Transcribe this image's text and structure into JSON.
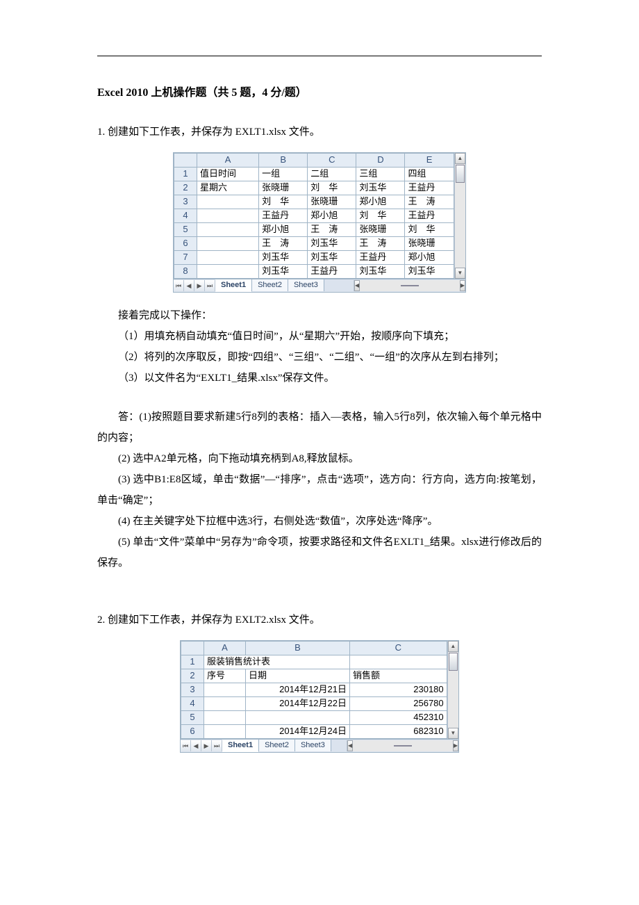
{
  "title": "Excel 2010 上机操作题（共 5 题，4 分/题）",
  "q1_line": "1. 创建如下工作表，并保存为 EXLT1.xlsx 文件。",
  "table1": {
    "cols": [
      "A",
      "B",
      "C",
      "D",
      "E"
    ],
    "rows": [
      {
        "n": "1",
        "cells": [
          "值日时间",
          "一组",
          "二组",
          "三组",
          "四组"
        ]
      },
      {
        "n": "2",
        "cells": [
          "星期六",
          "张晓珊",
          "刘　华",
          "刘玉华",
          "王益丹"
        ]
      },
      {
        "n": "3",
        "cells": [
          "",
          "刘　华",
          "张晓珊",
          "郑小旭",
          "王　涛"
        ]
      },
      {
        "n": "4",
        "cells": [
          "",
          "王益丹",
          "郑小旭",
          "刘　华",
          "王益丹"
        ]
      },
      {
        "n": "5",
        "cells": [
          "",
          "郑小旭",
          "王　涛",
          "张晓珊",
          "刘　华"
        ]
      },
      {
        "n": "6",
        "cells": [
          "",
          "王　涛",
          "刘玉华",
          "王　涛",
          "张晓珊"
        ]
      },
      {
        "n": "7",
        "cells": [
          "",
          "刘玉华",
          "刘玉华",
          "王益丹",
          "郑小旭"
        ]
      },
      {
        "n": "8",
        "cells": [
          "",
          "刘玉华",
          "王益丹",
          "刘玉华",
          "刘玉华"
        ]
      }
    ],
    "tabs": [
      "Sheet1",
      "Sheet2",
      "Sheet3"
    ]
  },
  "p_intro": "接着完成以下操作：",
  "p1": "（1）用填充柄自动填充“值日时间”，从“星期六”开始，按顺序向下填充；",
  "p2": "（2）将列的次序取反，即按“四组”、“三组”、“二组”、“一组”的次序从左到右排列；",
  "p3": "（3）以文件名为“EXLT1_结果.xlsx”保存文件。",
  "a_label": "答：",
  "a1": "(1)按照题目要求新建5行8列的表格：插入—表格，输入5行8列，依次输入每个单元格中的内容；",
  "a2": "(2) 选中A2单元格，向下拖动填充柄到A8,释放鼠标。",
  "a3": "(3) 选中B1:E8区域，单击“数据”—“排序”，点击“选项”，选方向：行方向，选方向:按笔划，单击“确定”；",
  "a4": "(4) 在主关键字处下拉框中选3行，右侧处选“数值”，次序处选“降序”。",
  "a5": "(5) 单击“文件”菜单中“另存为”命令项，按要求路径和文件名EXLT1_结果。xlsx进行修改后的保存。",
  "q2_line": "2. 创建如下工作表，并保存为 EXLT2.xlsx 文件。",
  "table2": {
    "cols": [
      "A",
      "B",
      "C"
    ],
    "rows": [
      {
        "n": "1",
        "cells": [
          "服装销售统计表",
          "",
          ""
        ]
      },
      {
        "n": "2",
        "cells": [
          "序号",
          "日期",
          "销售额"
        ]
      },
      {
        "n": "3",
        "cells": [
          "",
          "2014年12月21日",
          "230180"
        ]
      },
      {
        "n": "4",
        "cells": [
          "",
          "2014年12月22日",
          "256780"
        ]
      },
      {
        "n": "5",
        "cells": [
          "",
          "",
          "452310"
        ]
      },
      {
        "n": "6",
        "cells": [
          "",
          "2014年12月24日",
          "682310"
        ]
      }
    ],
    "tabs": [
      "Sheet1",
      "Sheet2",
      "Sheet3"
    ]
  }
}
